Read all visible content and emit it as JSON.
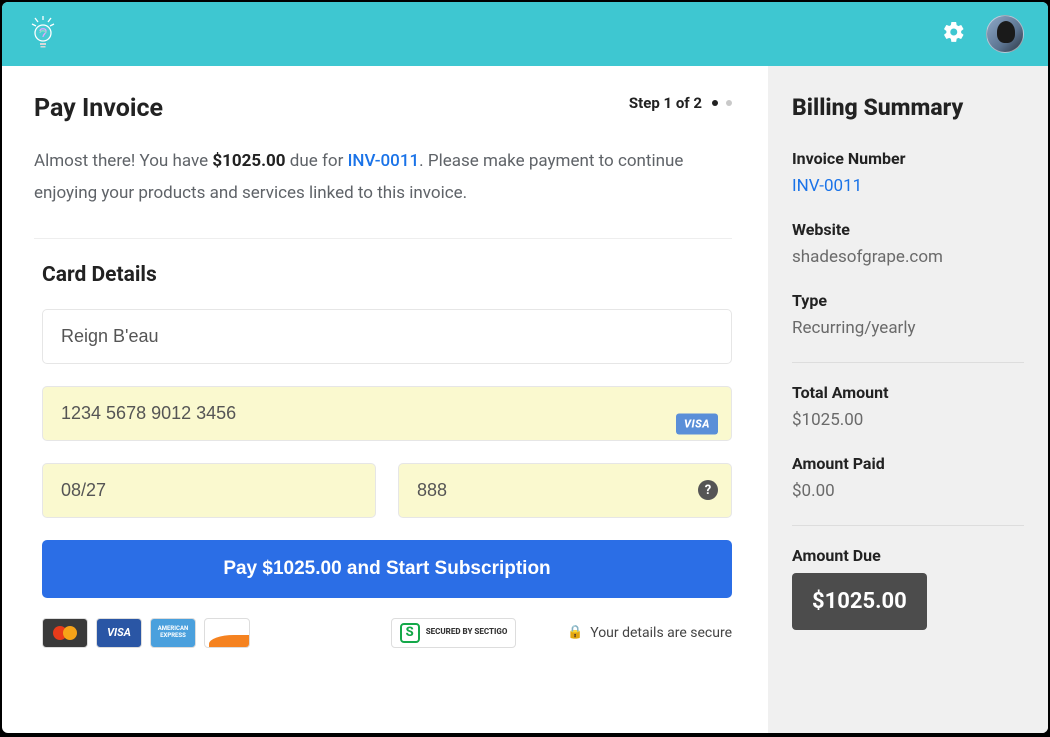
{
  "header": {
    "gear_icon": "gear-icon",
    "avatar": "user-avatar"
  },
  "step": {
    "label": "Step 1 of 2"
  },
  "page_title": "Pay Invoice",
  "subtext": {
    "prefix": "Almost there! You have ",
    "amount": "$1025.00",
    "middle": " due for ",
    "invoice_link": "INV-0011",
    "suffix": ". Please make payment to continue enjoying your products and services linked to this invoice."
  },
  "card_details": {
    "title": "Card Details",
    "name_value": "Reign B'eau",
    "card_number_value": "1234 5678 9012 3456",
    "card_brand": "VISA",
    "expiry_value": "08/27",
    "cvv_value": "888",
    "help": "?"
  },
  "pay_button": "Pay $1025.00 and Start Subscription",
  "card_brands": {
    "visa": "VISA",
    "amex": "AMERICAN EXPRESS",
    "discover": "DISCOVER"
  },
  "secured_by": {
    "mark": "S",
    "line": "SECURED BY SECTIGO"
  },
  "secure_note": "Your details are secure",
  "billing": {
    "title": "Billing Summary",
    "invoice_number_label": "Invoice Number",
    "invoice_number": "INV-0011",
    "website_label": "Website",
    "website": "shadesofgrape.com",
    "type_label": "Type",
    "type": "Recurring/yearly",
    "total_label": "Total Amount",
    "total": "$1025.00",
    "paid_label": "Amount Paid",
    "paid": "$0.00",
    "due_label": "Amount Due",
    "due": "$1025.00"
  }
}
